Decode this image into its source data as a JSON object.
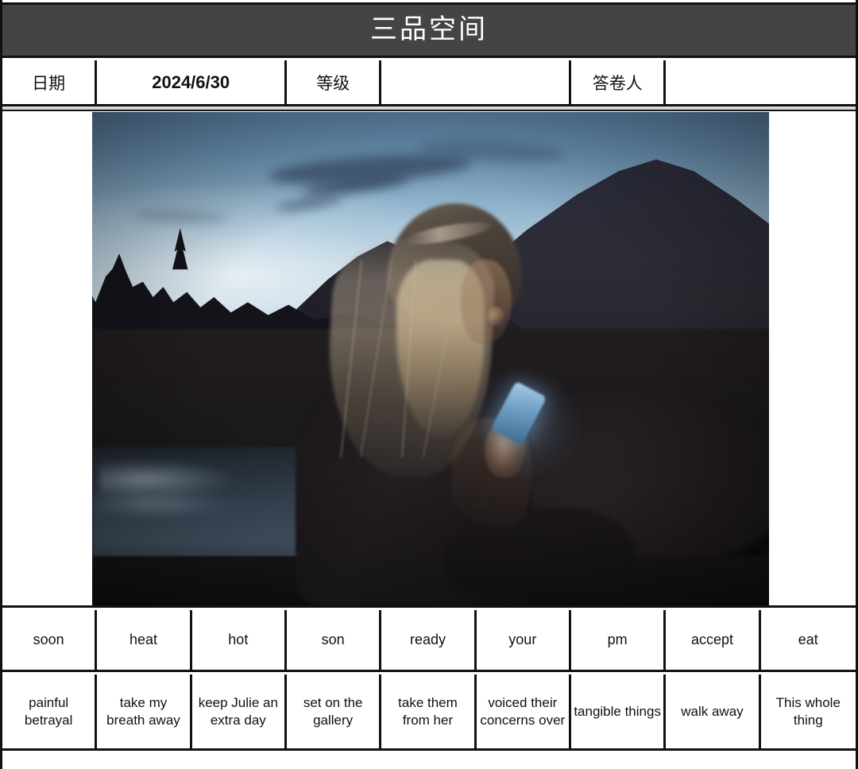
{
  "header": {
    "title": "三品空间",
    "bar_color": "#444444",
    "title_color": "#ffffff"
  },
  "info_row": {
    "cells": [
      {
        "label": "日期",
        "kind": "label"
      },
      {
        "label": "2024/6/30",
        "kind": "value"
      },
      {
        "label": "等级",
        "kind": "label"
      },
      {
        "label": "",
        "kind": "blank"
      },
      {
        "label": "答卷人",
        "kind": "label"
      },
      {
        "label": "",
        "kind": "blank"
      }
    ]
  },
  "photo": {
    "alt": "Young woman with long blonde hair sitting cross-legged by a lake at dusk, face lit by the glow of her smartphone, dark mountains and treeline behind her",
    "scene": "dusk-lakeside-phone-glow"
  },
  "word_row": {
    "cells": [
      "soon",
      "heat",
      "hot",
      "son",
      "ready",
      "your",
      "pm",
      "accept",
      "eat"
    ]
  },
  "phrase_row": {
    "cells": [
      "painful betrayal",
      "take my breath away",
      "keep Julie an extra day",
      "set on the gallery",
      "take them from her",
      "voiced their concerns over",
      "tangible things",
      "walk away",
      "This whole thing"
    ]
  }
}
